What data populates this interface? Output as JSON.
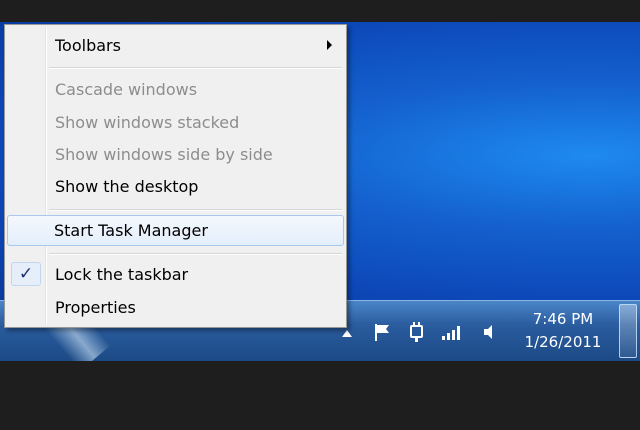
{
  "context_menu": {
    "items": [
      {
        "label": "Toolbars",
        "enabled": true,
        "submenu": true
      },
      {
        "label": "Cascade windows",
        "enabled": false
      },
      {
        "label": "Show windows stacked",
        "enabled": false
      },
      {
        "label": "Show windows side by side",
        "enabled": false
      },
      {
        "label": "Show the desktop",
        "enabled": true
      },
      {
        "label": "Start Task Manager",
        "enabled": true,
        "highlighted": true
      },
      {
        "label": "Lock the taskbar",
        "enabled": true,
        "checked": true
      },
      {
        "label": "Properties",
        "enabled": true
      }
    ],
    "check_glyph": "✓"
  },
  "taskbar": {
    "clock": {
      "time": "7:46 PM",
      "date": "1/26/2011"
    },
    "tray_icons": [
      "show-hidden-icons-arrow",
      "action-center-flag-icon",
      "power-plug-icon",
      "network-signal-icon",
      "volume-speaker-icon"
    ]
  },
  "colors": {
    "desktop": "#1461cf",
    "taskbar": "#2a5c9e",
    "menu_background": "#f0f0f0",
    "disabled_text": "#8d8d8d",
    "highlight_border": "#a8c8ef"
  }
}
